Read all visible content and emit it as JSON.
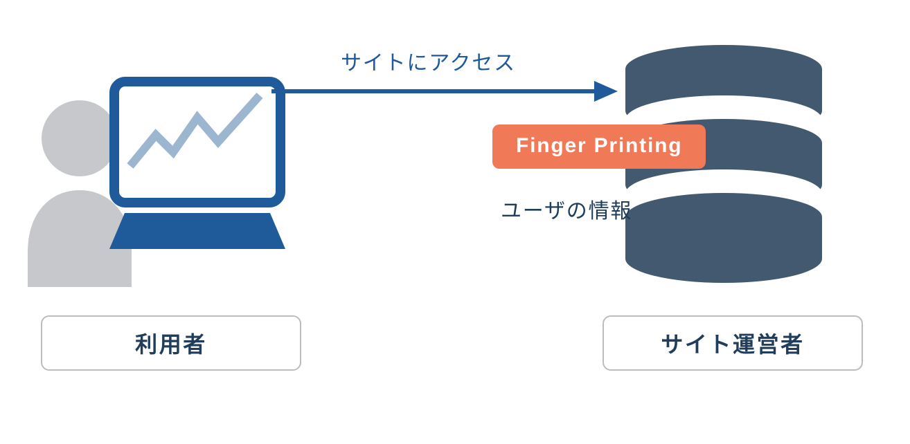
{
  "colors": {
    "primary_blue": "#1f5a9b",
    "dark_navy": "#42596f",
    "orange": "#f07958",
    "text_navy": "#213d5c",
    "person_gray": "#c6c8cb",
    "box_border": "#b9bdc1"
  },
  "arrow": {
    "label": "サイトにアクセス"
  },
  "finger_printing": {
    "label": "Finger Printing",
    "sub_label": "ユーザの情報"
  },
  "left_role": {
    "label": "利用者"
  },
  "right_role": {
    "label": "サイト運営者"
  },
  "icons": {
    "user": "person-icon",
    "laptop_chart": "laptop-chart-icon",
    "database": "database-icon",
    "arrow": "arrow-right-icon"
  }
}
